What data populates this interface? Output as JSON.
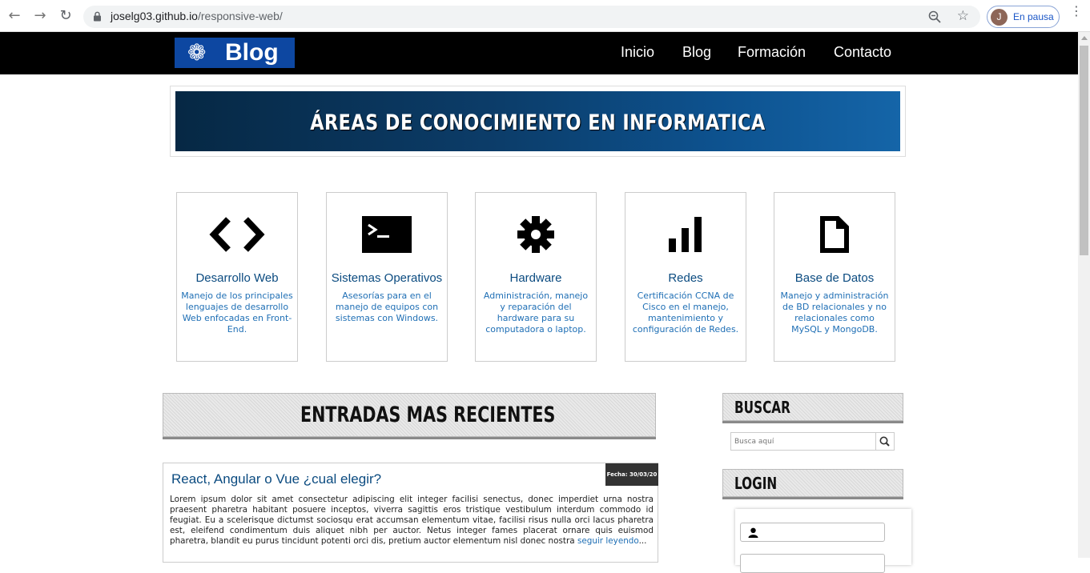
{
  "browser": {
    "url_host": "joselg03.github.io",
    "url_path": "/responsive-web/",
    "profile_initial": "J",
    "profile_status": "En pausa"
  },
  "site": {
    "logo_text": "Blog",
    "nav": [
      "Inicio",
      "Blog",
      "Formación",
      "Contacto"
    ],
    "banner_title": "ÁREAS DE CONOCIMIENTO EN INFORMATICA"
  },
  "areas": [
    {
      "icon": "code-icon",
      "title": "Desarrollo Web",
      "description": "Manejo de los principales lenguajes de desarrollo Web enfocadas en Front-End."
    },
    {
      "icon": "terminal-icon",
      "title": "Sistemas Operativos",
      "description": "Asesorías para en el manejo de equipos con sistemas con Windows."
    },
    {
      "icon": "gear-icon",
      "title": "Hardware",
      "description": "Administración, manejo y reparación del hardware para su computadora o laptop."
    },
    {
      "icon": "signal-bars-icon",
      "title": "Redes",
      "description": "Certificación CCNA de Cisco en el manejo, mantenimiento y configuración de Redes."
    },
    {
      "icon": "file-icon",
      "title": "Base de Datos",
      "description": "Manejo y administración de BD relacionales y no relacionales como MySQL y MongoDB."
    }
  ],
  "recent": {
    "heading": "ENTRADAS MAS RECIENTES",
    "post": {
      "title": "React, Angular o Vue ¿cual elegir?",
      "date": "Fecha: 30/03/20",
      "body": "Lorem ipsum dolor sit amet consectetur adipiscing elit integer facilisi senectus, donec imperdiet urna nostra praesent pharetra habitant posuere inceptos, viverra sagittis eros tristique vestibulum interdum commodo id feugiat. Eu a scelerisque dictumst sociosqu erat accumsan elementum vitae, facilisi risus nulla orci lacus pharetra est, eleifend condimentum duis aliquet nibh per auctor. Netus integer fames placerat ornare quis euismod pharetra, blandit eu purus tincidunt potenti orci dis, pretium auctor elementum nisl donec nostra",
      "more": "seguir leyendo",
      "ellipsis": "..."
    }
  },
  "sidebar": {
    "search_heading": "BUSCAR",
    "search_placeholder": "Busca aquí",
    "login_heading": "LOGIN"
  }
}
